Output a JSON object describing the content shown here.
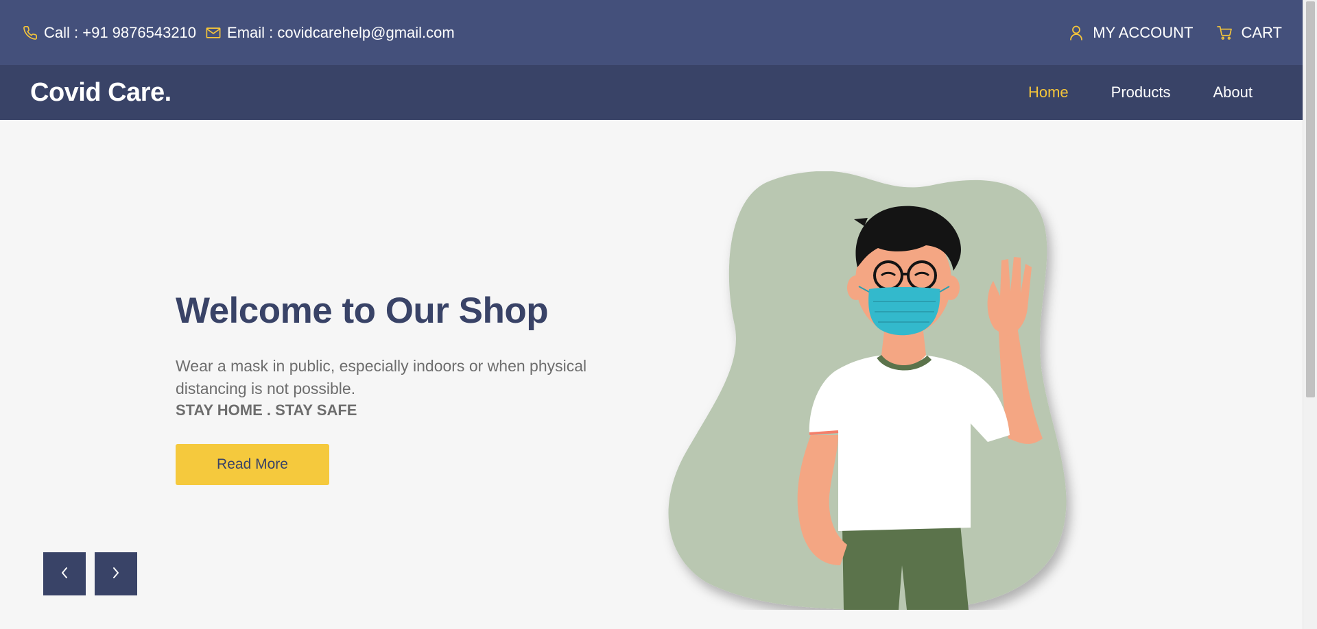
{
  "topbar": {
    "call_label": "Call : +91 9876543210",
    "email_label": "Email : covidcarehelp@gmail.com",
    "account_label": "MY ACCOUNT",
    "cart_label": "CART",
    "icons": {
      "call": "phone-icon",
      "email": "mail-icon",
      "account": "user-icon",
      "cart": "cart-icon"
    }
  },
  "navbar": {
    "logo": "Covid Care.",
    "links": [
      {
        "label": "Home",
        "active": true
      },
      {
        "label": "Products",
        "active": false
      },
      {
        "label": "About",
        "active": false
      }
    ]
  },
  "hero": {
    "title": "Welcome to Our Shop",
    "description": "Wear a mask in public, especially indoors or when physical distancing is not possible.",
    "tagline": "STAY HOME . STAY SAFE",
    "button_label": "Read More"
  },
  "slider": {
    "prev_icon": "chevron-left-icon",
    "next_icon": "chevron-right-icon"
  },
  "colors": {
    "topbar_bg": "#44507b",
    "navbar_bg": "#394367",
    "accent": "#f5c53a",
    "button_bg": "#f5c93d",
    "title_color": "#394367",
    "mask_color": "#33b9cc",
    "blob_color": "#b9c7b1"
  }
}
